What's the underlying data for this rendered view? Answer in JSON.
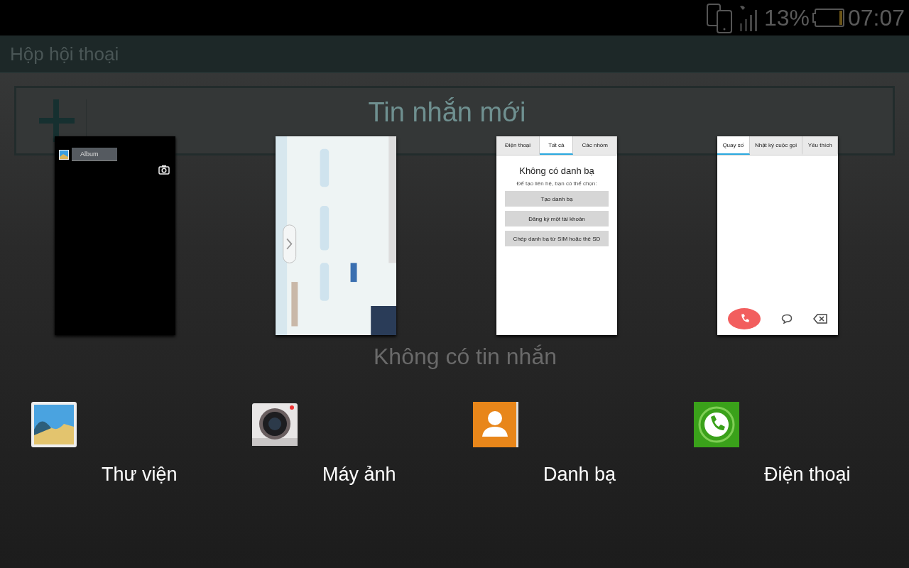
{
  "status_bar": {
    "battery_percent": "13%",
    "time": "07:07"
  },
  "background_app": {
    "title": "Hộp hội thoại",
    "new_message_button": "Tin nhắn mới",
    "empty_text": "Không có tin nhắn"
  },
  "recent_apps": [
    {
      "kind": "gallery",
      "label": "Thư viện",
      "screen": {
        "album_dropdown": "Album"
      }
    },
    {
      "kind": "camera",
      "label": "Máy ảnh"
    },
    {
      "kind": "contacts",
      "label": "Danh bạ",
      "screen": {
        "tabs": [
          {
            "label": "Điện thoại",
            "selected": false
          },
          {
            "label": "Tất cả",
            "selected": true
          },
          {
            "label": "Các nhóm",
            "selected": false
          }
        ],
        "title": "Không có danh bạ",
        "hint": "Để tạo liên hệ, bạn có thể chọn:",
        "buttons": [
          "Tạo danh bạ",
          "Đăng ký một tài khoản",
          "Chép danh bạ từ SIM hoặc thẻ SD"
        ]
      }
    },
    {
      "kind": "phone",
      "label": "Điện thoại",
      "screen": {
        "tabs": [
          {
            "label": "Quay số",
            "selected": true
          },
          {
            "label": "Nhật ký cuộc gọi",
            "selected": false
          },
          {
            "label": "Yêu thích",
            "selected": false
          }
        ]
      }
    }
  ]
}
